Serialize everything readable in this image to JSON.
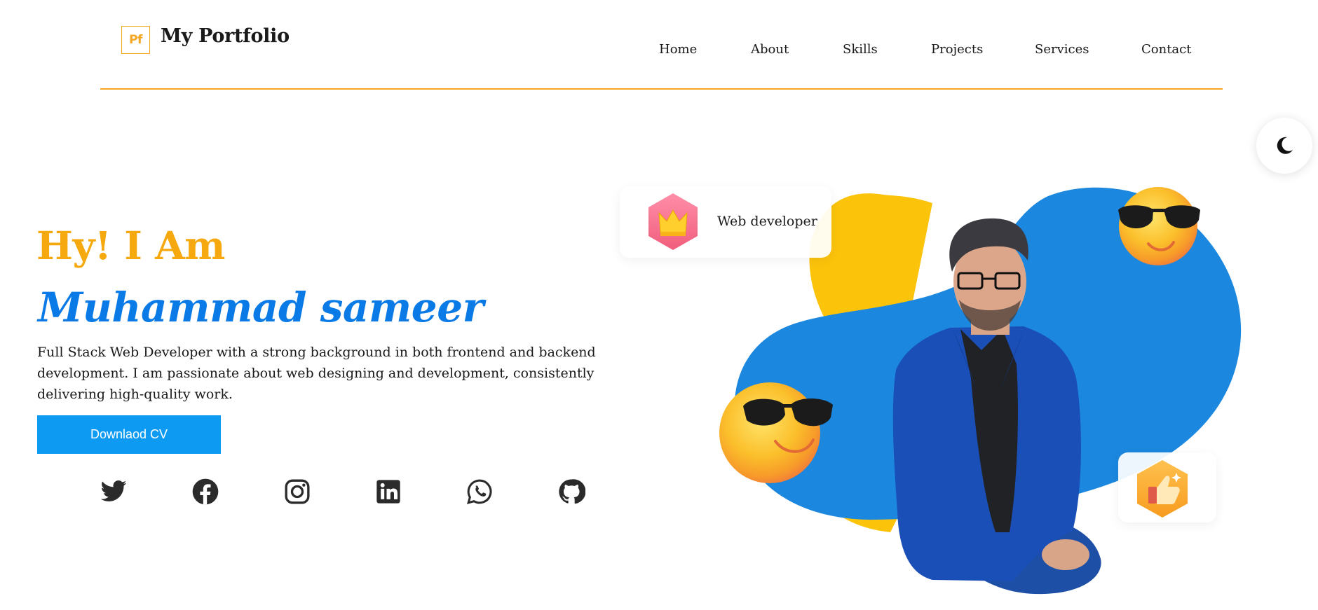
{
  "header": {
    "logo_mark": "Pf",
    "logo_text": "My Portfolio",
    "nav": [
      "Home",
      "About",
      "Skills",
      "Projects",
      "Services",
      "Contact"
    ]
  },
  "hero": {
    "greeting": "Hy! I Am",
    "name": "Muhammad sameer",
    "bio": "Full Stack Web Developer with a strong background in both frontend and backend development. I am passionate about web designing and development, consistently delivering high-quality work.",
    "cv_button": "Downlaod CV",
    "badge_text": "Web developer"
  },
  "social_icons": [
    "twitter-icon",
    "facebook-icon",
    "instagram-icon",
    "linkedin-icon",
    "whatsapp-icon",
    "github-icon"
  ],
  "icons": {
    "theme_toggle": "moon-icon",
    "badge": "crown-icon",
    "like": "thumbs-up-icon"
  },
  "colors": {
    "accent_orange": "#f5a623",
    "greeting": "#f6a90f",
    "name_blue": "#0a7be6",
    "button_blue": "#0d9af2",
    "blob_yellow": "#fcc30b",
    "blob_blue": "#1b87de"
  }
}
